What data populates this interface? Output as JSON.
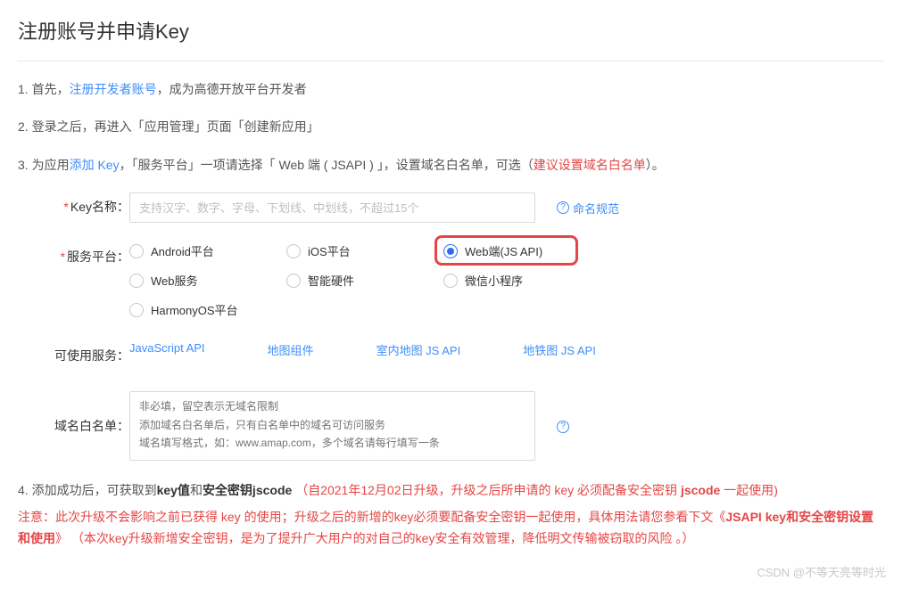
{
  "title": "注册账号并申请Key",
  "steps": {
    "s1_pre": "1. 首先，",
    "s1_link": "注册开发者账号",
    "s1_post": "，成为高德开放平台开发者",
    "s2": "2. 登录之后，再进入「应用管理」页面「创建新应用」",
    "s3_pre": "3. 为应用",
    "s3_link": "添加 Key",
    "s3_mid": "，「服务平台」一项请选择「 Web 端 ( JSAPI ) 」，设置域名白名单，可选（",
    "s3_warn": "建议设置域名白名单",
    "s3_post": "）。"
  },
  "form": {
    "keyName": {
      "label": "Key名称：",
      "placeholder": "支持汉字、数字、字母、下划线、中划线，不超过15个",
      "help": "命名规范"
    },
    "platform": {
      "label": "服务平台：",
      "opts": [
        "Android平台",
        "iOS平台",
        "Web端(JS API)",
        "Web服务",
        "智能硬件",
        "微信小程序",
        "HarmonyOS平台"
      ]
    },
    "services": {
      "label": "可使用服务：",
      "links": [
        "JavaScript API",
        "地图组件",
        "室内地图 JS API",
        "地铁图 JS API"
      ]
    },
    "domain": {
      "label": "域名白名单：",
      "placeholder": "非必填，留空表示无域名限制\n添加域名白名单后，只有白名单中的域名可访问服务\n域名填写格式，如：www.amap.com，多个域名请每行填写一条"
    }
  },
  "post": {
    "p1_pre": "4. 添加成功后，可获取到",
    "p1_b1": "key值",
    "p1_mid": "和",
    "p1_b2": "安全密钥jscode",
    "p1_r_open": "（",
    "p1_r_text1": "自2021年12月02日升级，升级之后所申请的 key 必须配备安全密钥 ",
    "p1_r_bold": "jscode",
    "p1_r_text2": " 一起使用",
    "p1_r_close": ")",
    "p2_a": "注意：此次升级不会影响之前已获得 key 的使用；升级之后的新增的key必须要配备安全密钥一起使用，具体用法请您参看下文《",
    "p2_bold": "JSAPI key和安全密钥设置和使用",
    "p2_b": "》",
    "p2_c": "（本次key升级新增安全密钥，是为了提升广大用户的对自己的key安全有效管理，降低明文传输被窃取的风险 。）"
  },
  "watermark": "CSDN @不等天亮等时光"
}
